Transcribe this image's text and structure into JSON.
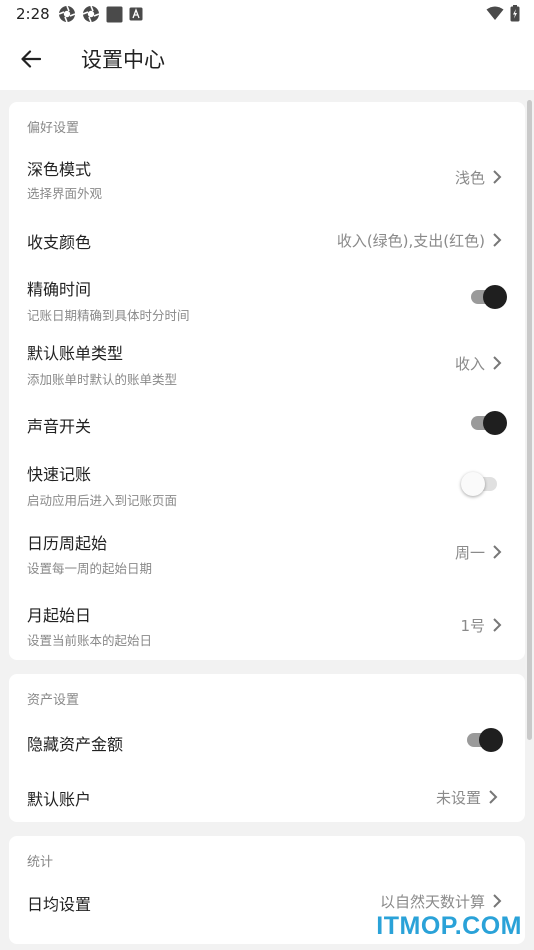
{
  "status_bar": {
    "time": "2:28",
    "left_icons": [
      "aperture-icon",
      "aperture-icon",
      "square-icon",
      "font-a-icon"
    ],
    "right_icons": [
      "wifi-icon",
      "battery-icon"
    ]
  },
  "header": {
    "title": "设置中心",
    "back_icon": "arrow-left-icon"
  },
  "sections": [
    {
      "title": "偏好设置",
      "rows": [
        {
          "title": "深色模式",
          "subtitle": "选择界面外观",
          "value": "浅色",
          "control": "chevron"
        },
        {
          "title": "收支颜色",
          "value": "收入(绿色),支出(红色)",
          "control": "chevron"
        },
        {
          "title": "精确时间",
          "subtitle": "记账日期精确到具体时分时间",
          "control": "switch",
          "on": true
        },
        {
          "title": "默认账单类型",
          "subtitle": "添加账单时默认的账单类型",
          "value": "收入",
          "control": "chevron"
        },
        {
          "title": "声音开关",
          "control": "switch",
          "on": true
        },
        {
          "title": "快速记账",
          "subtitle": "启动应用后进入到记账页面",
          "control": "switch",
          "on": false
        },
        {
          "title": "日历周起始",
          "subtitle": "设置每一周的起始日期",
          "value": "周一",
          "control": "chevron"
        },
        {
          "title": "月起始日",
          "subtitle": "设置当前账本的起始日",
          "value": "1号",
          "control": "chevron"
        }
      ]
    },
    {
      "title": "资产设置",
      "rows": [
        {
          "title": "隐藏资产金额",
          "control": "switch",
          "on": true
        },
        {
          "title": "默认账户",
          "value": "未设置",
          "control": "chevron"
        }
      ]
    },
    {
      "title": "统计",
      "rows": [
        {
          "title": "日均设置",
          "value": "以自然天数计算",
          "control": "chevron"
        }
      ]
    }
  ],
  "watermark": "ITMOP.COM",
  "colors": {
    "background": "#f2f2f2",
    "card": "#ffffff",
    "switch_on_knob": "#1f1f1f",
    "switch_on_track": "#9a9a9a",
    "switch_off_knob": "#fafafa",
    "switch_off_track": "#e0e0e0",
    "secondary_text": "#8a8a8a",
    "watermark": "#2aa2d8"
  }
}
